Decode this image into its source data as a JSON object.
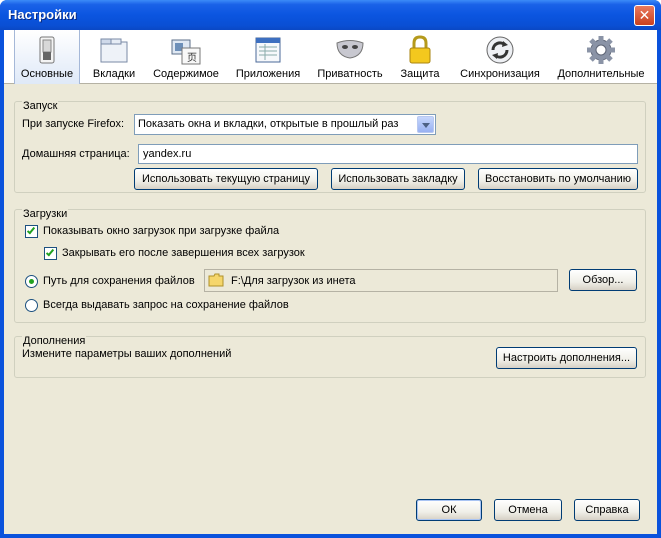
{
  "window": {
    "title": "Настройки",
    "close_glyph": "✕"
  },
  "toolbar": {
    "panes": [
      {
        "label": "Основные",
        "icon": "switch-icon",
        "selected": true
      },
      {
        "label": "Вкладки",
        "icon": "folder-tabs-icon",
        "selected": false
      },
      {
        "label": "Содержимое",
        "icon": "content-icon",
        "selected": false
      },
      {
        "label": "Приложения",
        "icon": "applications-icon",
        "selected": false
      },
      {
        "label": "Приватность",
        "icon": "mask-icon",
        "selected": false
      },
      {
        "label": "Защита",
        "icon": "lock-icon",
        "selected": false
      },
      {
        "label": "Синхронизация",
        "icon": "sync-icon",
        "selected": false
      },
      {
        "label": "Дополнительные",
        "icon": "gear-icon",
        "selected": false
      }
    ]
  },
  "startup": {
    "title": "Запуск",
    "when_label": "При запуске Firefox:",
    "when_value": "Показать окна и вкладки, открытые в прошлый раз",
    "home_label": "Домашняя страница:",
    "home_value": "yandex.ru",
    "use_current": "Использовать текущую страницу",
    "use_bookmark": "Использовать закладку",
    "restore_default": "Восстановить по умолчанию"
  },
  "downloads": {
    "title": "Загрузки",
    "show_window": "Показывать окно загрузок при загрузке файла",
    "show_window_checked": true,
    "close_when_done": "Закрывать его после завершения всех загрузок",
    "close_when_done_checked": true,
    "save_to_label": "Путь для сохранения файлов",
    "save_to_path": "F:\\Для загрузок из инета",
    "browse": "Обзор...",
    "always_ask": "Всегда выдавать запрос на сохранение файлов",
    "selected_option": "save_to"
  },
  "addons": {
    "title": "Дополнения",
    "description": "Измените параметры ваших дополнений",
    "manage": "Настроить дополнения..."
  },
  "footer": {
    "ok": "ОК",
    "cancel": "Отмена",
    "help": "Справка"
  },
  "colors": {
    "titlebar": "#0a52dc",
    "client_bg": "#ece9d8",
    "check": "#21a121",
    "focus": "#316ac5"
  }
}
